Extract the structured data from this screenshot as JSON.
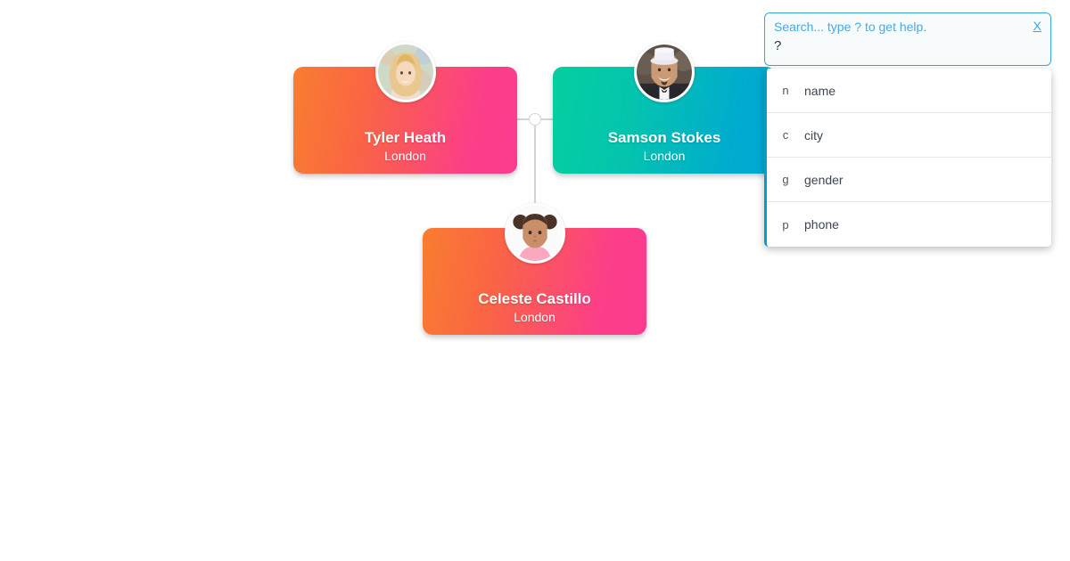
{
  "search": {
    "placeholder": "Search... type ? to get help.",
    "value": "?",
    "close_label": "X"
  },
  "suggestions": [
    {
      "key": "n",
      "label": "name"
    },
    {
      "key": "c",
      "label": "city"
    },
    {
      "key": "g",
      "label": "gender"
    },
    {
      "key": "p",
      "label": "phone"
    }
  ],
  "cards": [
    {
      "name": "Tyler Heath",
      "city": "London",
      "avatar": "woman-blonde-avatar",
      "gradient_from": "#f97d30",
      "gradient_to": "#fc3b90"
    },
    {
      "name": "Samson Stokes",
      "city": "London",
      "avatar": "man-white-hat-avatar",
      "gradient_from": "#05cfa0",
      "gradient_to": "#00a8d4"
    },
    {
      "name": "Celeste Castillo",
      "city": "London",
      "avatar": "girl-child-avatar",
      "gradient_from": "#f97d30",
      "gradient_to": "#fc3b90"
    }
  ]
}
